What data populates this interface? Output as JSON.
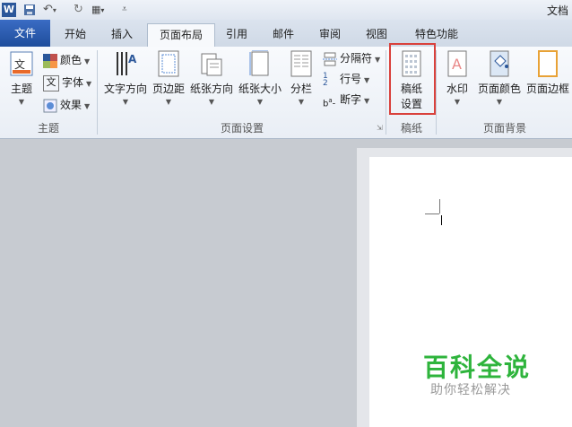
{
  "window": {
    "title": "文档"
  },
  "tabs": [
    {
      "label": "文件"
    },
    {
      "label": "开始"
    },
    {
      "label": "插入"
    },
    {
      "label": "页面布局"
    },
    {
      "label": "引用"
    },
    {
      "label": "邮件"
    },
    {
      "label": "审阅"
    },
    {
      "label": "视图"
    },
    {
      "label": "特色功能"
    }
  ],
  "ribbon": {
    "theme": {
      "group_label": "主题",
      "theme_btn": "主题",
      "colors": "颜色",
      "fonts": "字体",
      "effects": "效果"
    },
    "page_setup": {
      "group_label": "页面设置",
      "text_direction": "文字方向",
      "margins": "页边距",
      "orientation": "纸张方向",
      "size": "纸张大小",
      "columns": "分栏",
      "breaks": "分隔符",
      "line_numbers": "行号",
      "hyphenation": "断字"
    },
    "manuscript": {
      "group_label": "稿纸",
      "btn_line1": "稿纸",
      "btn_line2": "设置"
    },
    "page_background": {
      "group_label": "页面背景",
      "watermark": "水印",
      "page_color": "页面颜色",
      "page_borders": "页面边框"
    }
  },
  "watermark": {
    "title": "百科全说",
    "subtitle": "助你轻松解决"
  },
  "colors": {
    "file_tab": "#2b579a",
    "highlight": "#d9413c",
    "brand_green": "#2eb43c"
  }
}
